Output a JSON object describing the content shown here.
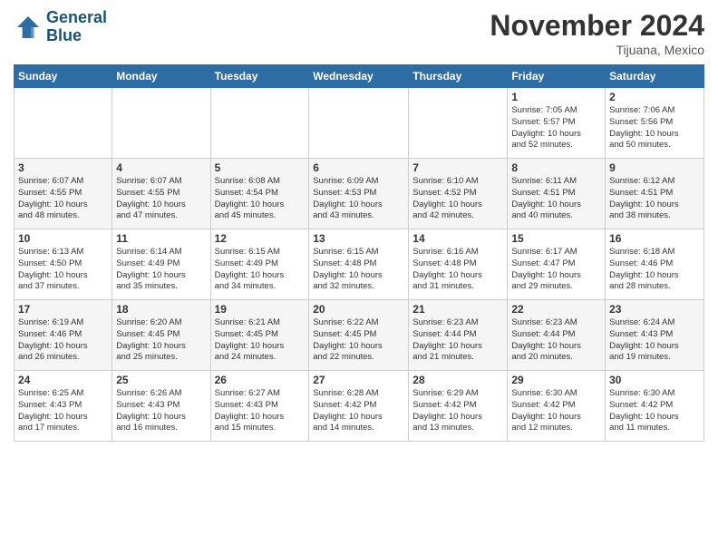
{
  "header": {
    "logo_line1": "General",
    "logo_line2": "Blue",
    "month_title": "November 2024",
    "location": "Tijuana, Mexico"
  },
  "weekdays": [
    "Sunday",
    "Monday",
    "Tuesday",
    "Wednesday",
    "Thursday",
    "Friday",
    "Saturday"
  ],
  "weeks": [
    [
      {
        "day": "",
        "info": ""
      },
      {
        "day": "",
        "info": ""
      },
      {
        "day": "",
        "info": ""
      },
      {
        "day": "",
        "info": ""
      },
      {
        "day": "",
        "info": ""
      },
      {
        "day": "1",
        "info": "Sunrise: 7:05 AM\nSunset: 5:57 PM\nDaylight: 10 hours\nand 52 minutes."
      },
      {
        "day": "2",
        "info": "Sunrise: 7:06 AM\nSunset: 5:56 PM\nDaylight: 10 hours\nand 50 minutes."
      }
    ],
    [
      {
        "day": "3",
        "info": "Sunrise: 6:07 AM\nSunset: 4:55 PM\nDaylight: 10 hours\nand 48 minutes."
      },
      {
        "day": "4",
        "info": "Sunrise: 6:07 AM\nSunset: 4:55 PM\nDaylight: 10 hours\nand 47 minutes."
      },
      {
        "day": "5",
        "info": "Sunrise: 6:08 AM\nSunset: 4:54 PM\nDaylight: 10 hours\nand 45 minutes."
      },
      {
        "day": "6",
        "info": "Sunrise: 6:09 AM\nSunset: 4:53 PM\nDaylight: 10 hours\nand 43 minutes."
      },
      {
        "day": "7",
        "info": "Sunrise: 6:10 AM\nSunset: 4:52 PM\nDaylight: 10 hours\nand 42 minutes."
      },
      {
        "day": "8",
        "info": "Sunrise: 6:11 AM\nSunset: 4:51 PM\nDaylight: 10 hours\nand 40 minutes."
      },
      {
        "day": "9",
        "info": "Sunrise: 6:12 AM\nSunset: 4:51 PM\nDaylight: 10 hours\nand 38 minutes."
      }
    ],
    [
      {
        "day": "10",
        "info": "Sunrise: 6:13 AM\nSunset: 4:50 PM\nDaylight: 10 hours\nand 37 minutes."
      },
      {
        "day": "11",
        "info": "Sunrise: 6:14 AM\nSunset: 4:49 PM\nDaylight: 10 hours\nand 35 minutes."
      },
      {
        "day": "12",
        "info": "Sunrise: 6:15 AM\nSunset: 4:49 PM\nDaylight: 10 hours\nand 34 minutes."
      },
      {
        "day": "13",
        "info": "Sunrise: 6:15 AM\nSunset: 4:48 PM\nDaylight: 10 hours\nand 32 minutes."
      },
      {
        "day": "14",
        "info": "Sunrise: 6:16 AM\nSunset: 4:48 PM\nDaylight: 10 hours\nand 31 minutes."
      },
      {
        "day": "15",
        "info": "Sunrise: 6:17 AM\nSunset: 4:47 PM\nDaylight: 10 hours\nand 29 minutes."
      },
      {
        "day": "16",
        "info": "Sunrise: 6:18 AM\nSunset: 4:46 PM\nDaylight: 10 hours\nand 28 minutes."
      }
    ],
    [
      {
        "day": "17",
        "info": "Sunrise: 6:19 AM\nSunset: 4:46 PM\nDaylight: 10 hours\nand 26 minutes."
      },
      {
        "day": "18",
        "info": "Sunrise: 6:20 AM\nSunset: 4:45 PM\nDaylight: 10 hours\nand 25 minutes."
      },
      {
        "day": "19",
        "info": "Sunrise: 6:21 AM\nSunset: 4:45 PM\nDaylight: 10 hours\nand 24 minutes."
      },
      {
        "day": "20",
        "info": "Sunrise: 6:22 AM\nSunset: 4:45 PM\nDaylight: 10 hours\nand 22 minutes."
      },
      {
        "day": "21",
        "info": "Sunrise: 6:23 AM\nSunset: 4:44 PM\nDaylight: 10 hours\nand 21 minutes."
      },
      {
        "day": "22",
        "info": "Sunrise: 6:23 AM\nSunset: 4:44 PM\nDaylight: 10 hours\nand 20 minutes."
      },
      {
        "day": "23",
        "info": "Sunrise: 6:24 AM\nSunset: 4:43 PM\nDaylight: 10 hours\nand 19 minutes."
      }
    ],
    [
      {
        "day": "24",
        "info": "Sunrise: 6:25 AM\nSunset: 4:43 PM\nDaylight: 10 hours\nand 17 minutes."
      },
      {
        "day": "25",
        "info": "Sunrise: 6:26 AM\nSunset: 4:43 PM\nDaylight: 10 hours\nand 16 minutes."
      },
      {
        "day": "26",
        "info": "Sunrise: 6:27 AM\nSunset: 4:43 PM\nDaylight: 10 hours\nand 15 minutes."
      },
      {
        "day": "27",
        "info": "Sunrise: 6:28 AM\nSunset: 4:42 PM\nDaylight: 10 hours\nand 14 minutes."
      },
      {
        "day": "28",
        "info": "Sunrise: 6:29 AM\nSunset: 4:42 PM\nDaylight: 10 hours\nand 13 minutes."
      },
      {
        "day": "29",
        "info": "Sunrise: 6:30 AM\nSunset: 4:42 PM\nDaylight: 10 hours\nand 12 minutes."
      },
      {
        "day": "30",
        "info": "Sunrise: 6:30 AM\nSunset: 4:42 PM\nDaylight: 10 hours\nand 11 minutes."
      }
    ]
  ]
}
